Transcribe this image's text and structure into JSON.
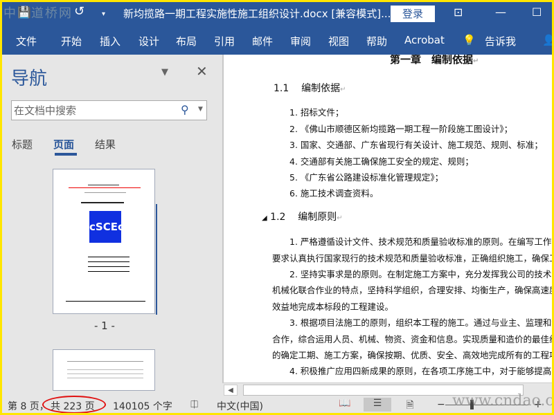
{
  "watermark_top": "中国道桥网",
  "watermark_bottom": "www.cndao.com",
  "titlebar": {
    "title": "新均揽路一期工程实施性施工组织设计.docx [兼容模式]...",
    "login": "登录",
    "icons": [
      "save-icon",
      "undo-icon",
      "customize-icon",
      "ribbon-display-icon",
      "minimize-icon",
      "maximize-icon"
    ]
  },
  "ribbon": {
    "tabs": [
      "文件",
      "开始",
      "插入",
      "设计",
      "布局",
      "引用",
      "邮件",
      "审阅",
      "视图",
      "帮助",
      "Acrobat"
    ],
    "tellme": "告诉我"
  },
  "nav": {
    "title": "导航",
    "search_placeholder": "在文档中搜索",
    "tabs": [
      "标题",
      "页面",
      "结果"
    ],
    "active_tab": "页面",
    "page_label": "- 1 -",
    "thumb_logo": "cSCEc"
  },
  "doc": {
    "chapter": "第一章　编制依据",
    "h1": {
      "num": "1.1",
      "text": "编制依据"
    },
    "list": [
      "1. 招标文件；",
      "2. 《佛山市顺德区新均揽路一期工程一阶段施工图设计》；",
      "3. 国家、交通部、广东省现行有关设计、施工规范、规则、标准；",
      "4. 交通部有关施工确保施工安全的规定、规则；",
      "5. 《广东省公路建设标准化管理规定》；",
      "6. 施工技术调查资料。"
    ],
    "h2": {
      "num": "1.2",
      "text": "编制原则"
    },
    "paras": [
      "1. 严格遵循设计文件、技术规范和质量验收标准的原则。在编写工作中，",
      "要求认真执行国家现行的技术规范和质量验收标准，正确组织施工，确保工程",
      "2. 坚持实事求是的原则。在制定施工方案中，充分发挥我公司的技术优势",
      "机械化联合作业的特点，坚持科学组织，合理安排、均衡生产，确保高速度、",
      "效益地完成本标段的工程建设。",
      "3. 根据项目法施工的原则，组织本工程的施工。通过与业主、监理和设计",
      "合作，综合运用人员、机械、物资、资金和信息。实现质量和造价的最佳组合",
      "的确定工期、施工方案，确保按期、优质、安全、高效地完成所有的工程项目",
      "4. 积极推广应用四新成果的原则，在各项工序施工中，对于能够提高工程"
    ]
  },
  "status": {
    "page": "第 8 页，",
    "total": "共 223 页",
    "words": "140105 个字",
    "lang": "中文(中国)",
    "zoom_minus": "−",
    "zoom_plus": "+"
  },
  "colors": {
    "accent": "#2b579a",
    "highlight": "#e01010"
  }
}
